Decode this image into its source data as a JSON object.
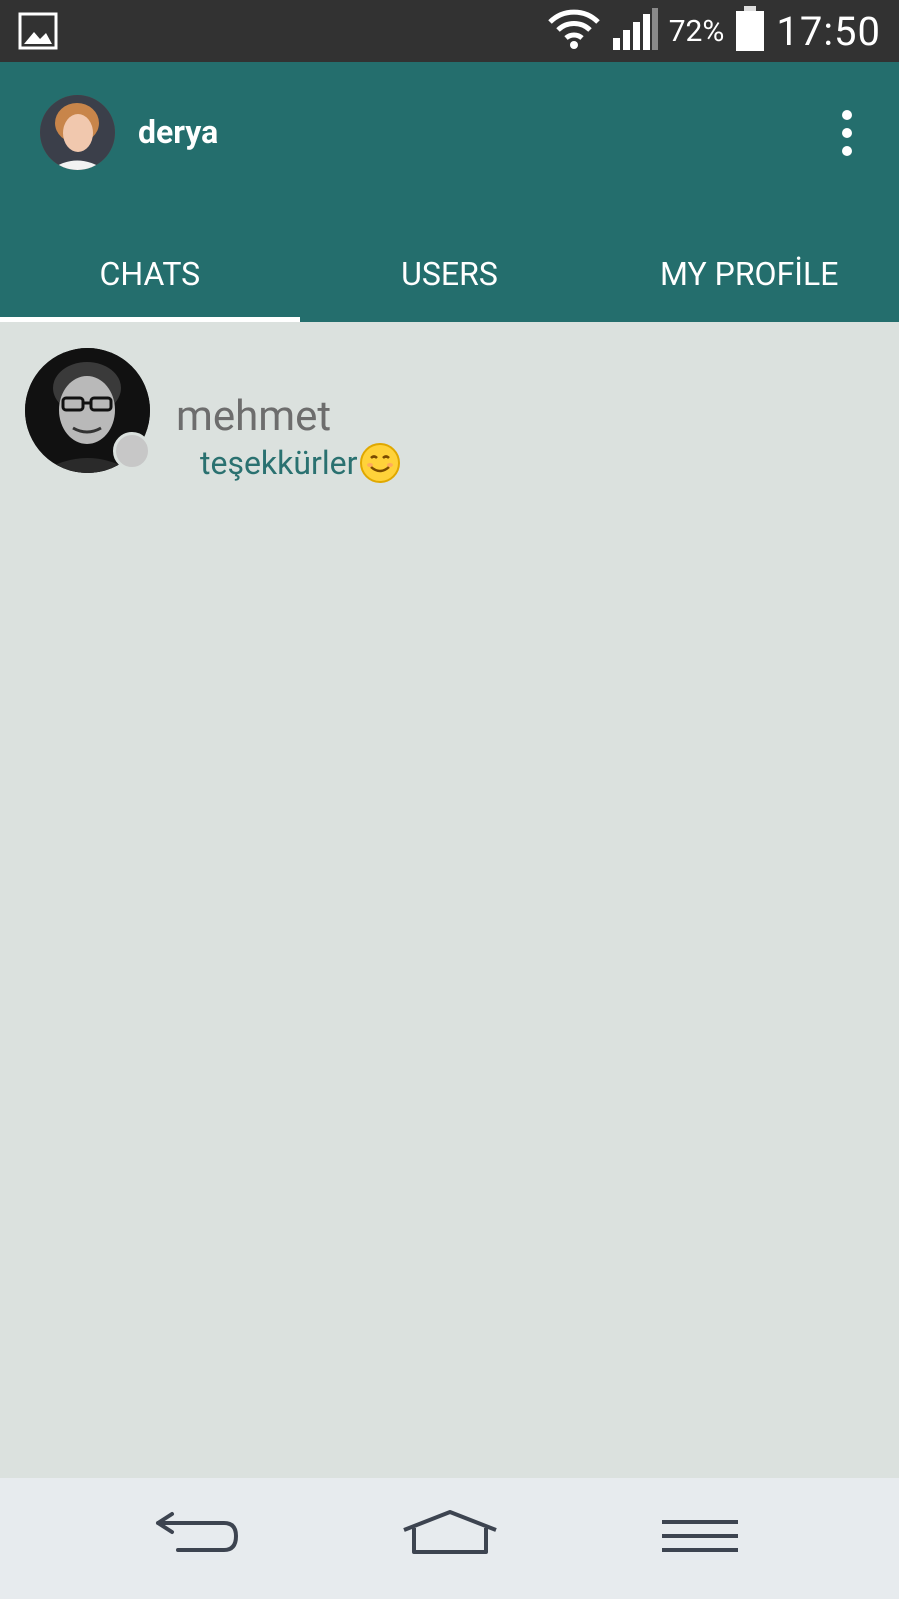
{
  "status_bar": {
    "battery_percent": "72%",
    "time": "17:50",
    "icons": [
      "image-icon",
      "wifi-icon",
      "signal-icon",
      "battery-icon"
    ]
  },
  "app_bar": {
    "user_name": "derya",
    "menu_icon": "overflow-menu-icon"
  },
  "tabs": [
    {
      "label": "CHATS",
      "active": true
    },
    {
      "label": "USERS",
      "active": false
    },
    {
      "label": "MY PROFİLE",
      "active": false
    }
  ],
  "chats": [
    {
      "name": "mehmet",
      "last_message": "teşekkürler",
      "status": "offline"
    }
  ],
  "navigation": {
    "icons": [
      "back-icon",
      "home-icon",
      "menu-icon"
    ]
  },
  "colors": {
    "primary": "#246e6d",
    "background": "#dbe1de",
    "message_text": "#2a7170",
    "name_text": "#6d6d6d"
  }
}
